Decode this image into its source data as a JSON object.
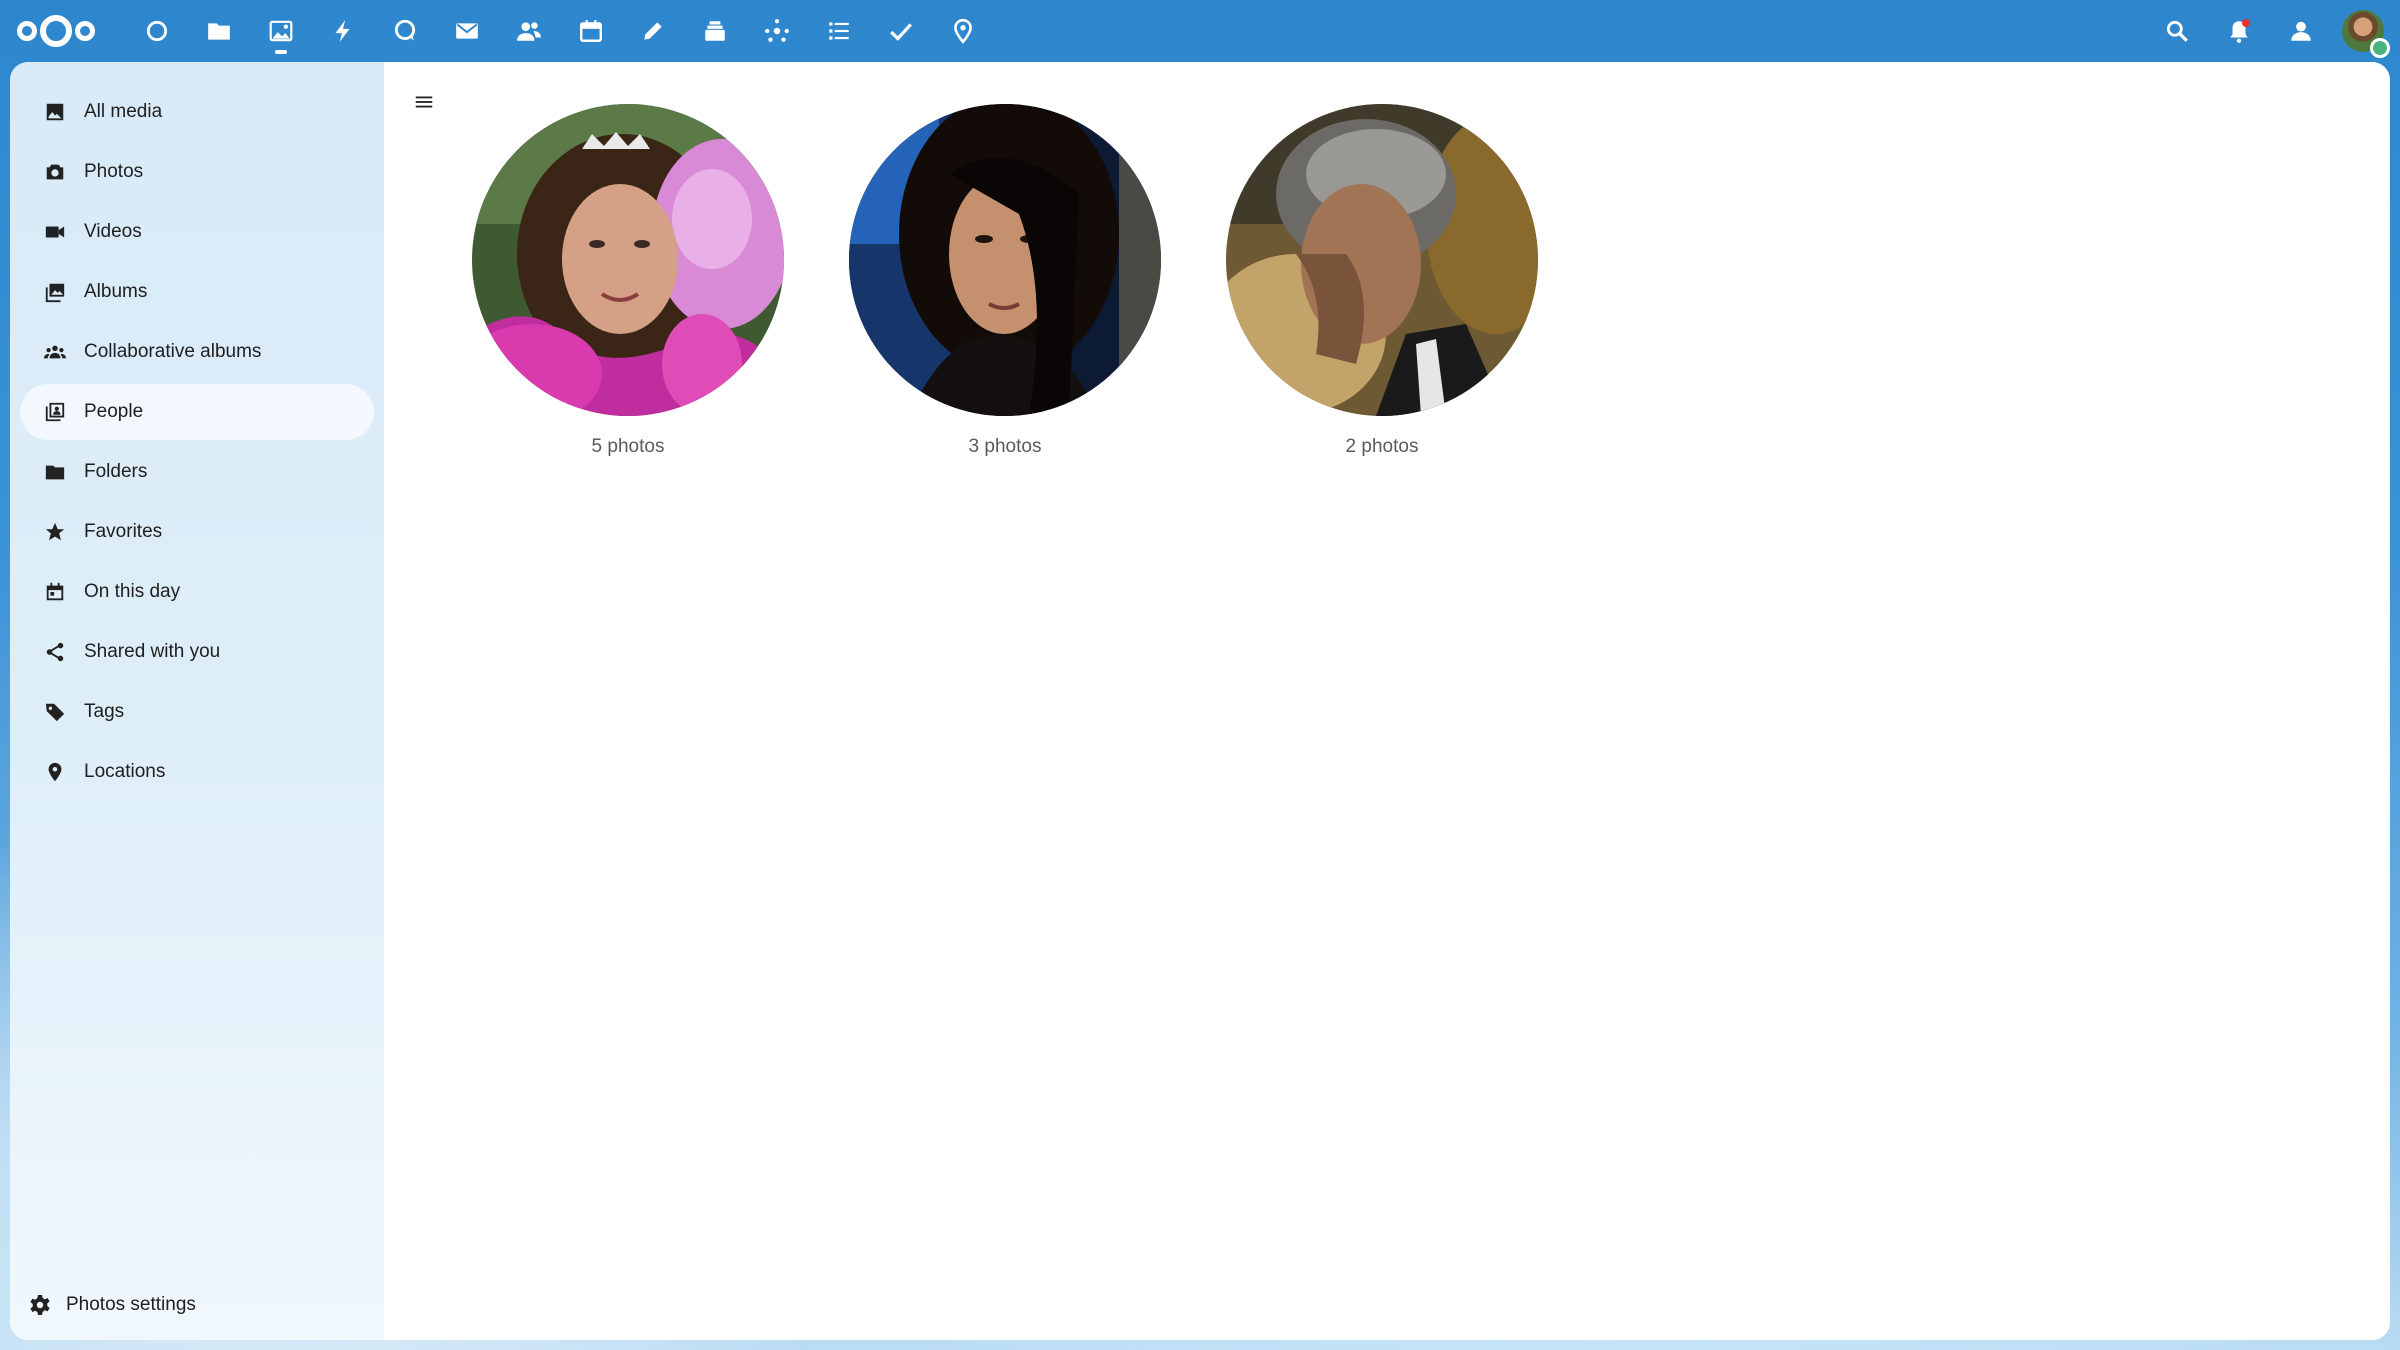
{
  "header": {
    "apps": [
      {
        "name": "dashboard-icon"
      },
      {
        "name": "files-icon"
      },
      {
        "name": "photos-icon",
        "active": true
      },
      {
        "name": "activity-icon"
      },
      {
        "name": "talk-icon"
      },
      {
        "name": "mail-icon"
      },
      {
        "name": "contacts-icon"
      },
      {
        "name": "calendar-icon"
      },
      {
        "name": "notes-icon"
      },
      {
        "name": "deck-icon"
      },
      {
        "name": "circles-icon"
      },
      {
        "name": "tasks-icon"
      },
      {
        "name": "checkmark-icon"
      },
      {
        "name": "maps-icon"
      }
    ],
    "right_icons": [
      "search-icon",
      "notifications-icon",
      "contacts-menu-icon",
      "avatar"
    ]
  },
  "sidebar": {
    "items": [
      {
        "label": "All media",
        "icon": "image-icon"
      },
      {
        "label": "Photos",
        "icon": "camera-icon"
      },
      {
        "label": "Videos",
        "icon": "video-icon"
      },
      {
        "label": "Albums",
        "icon": "albums-icon"
      },
      {
        "label": "Collaborative albums",
        "icon": "group-icon"
      },
      {
        "label": "People",
        "icon": "people-icon",
        "active": true
      },
      {
        "label": "Folders",
        "icon": "folder-icon"
      },
      {
        "label": "Favorites",
        "icon": "star-icon"
      },
      {
        "label": "On this day",
        "icon": "calendar-icon"
      },
      {
        "label": "Shared with you",
        "icon": "share-icon"
      },
      {
        "label": "Tags",
        "icon": "tag-icon"
      },
      {
        "label": "Locations",
        "icon": "location-icon"
      }
    ],
    "footer_label": "Photos settings"
  },
  "people": [
    {
      "count_label": "5 photos"
    },
    {
      "count_label": "3 photos"
    },
    {
      "count_label": "2 photos"
    }
  ],
  "colors": {
    "brand": "#2a85cf",
    "sidebar_bg": "#d6e9f7",
    "status_online": "#49b382",
    "notification": "#e9322d"
  }
}
